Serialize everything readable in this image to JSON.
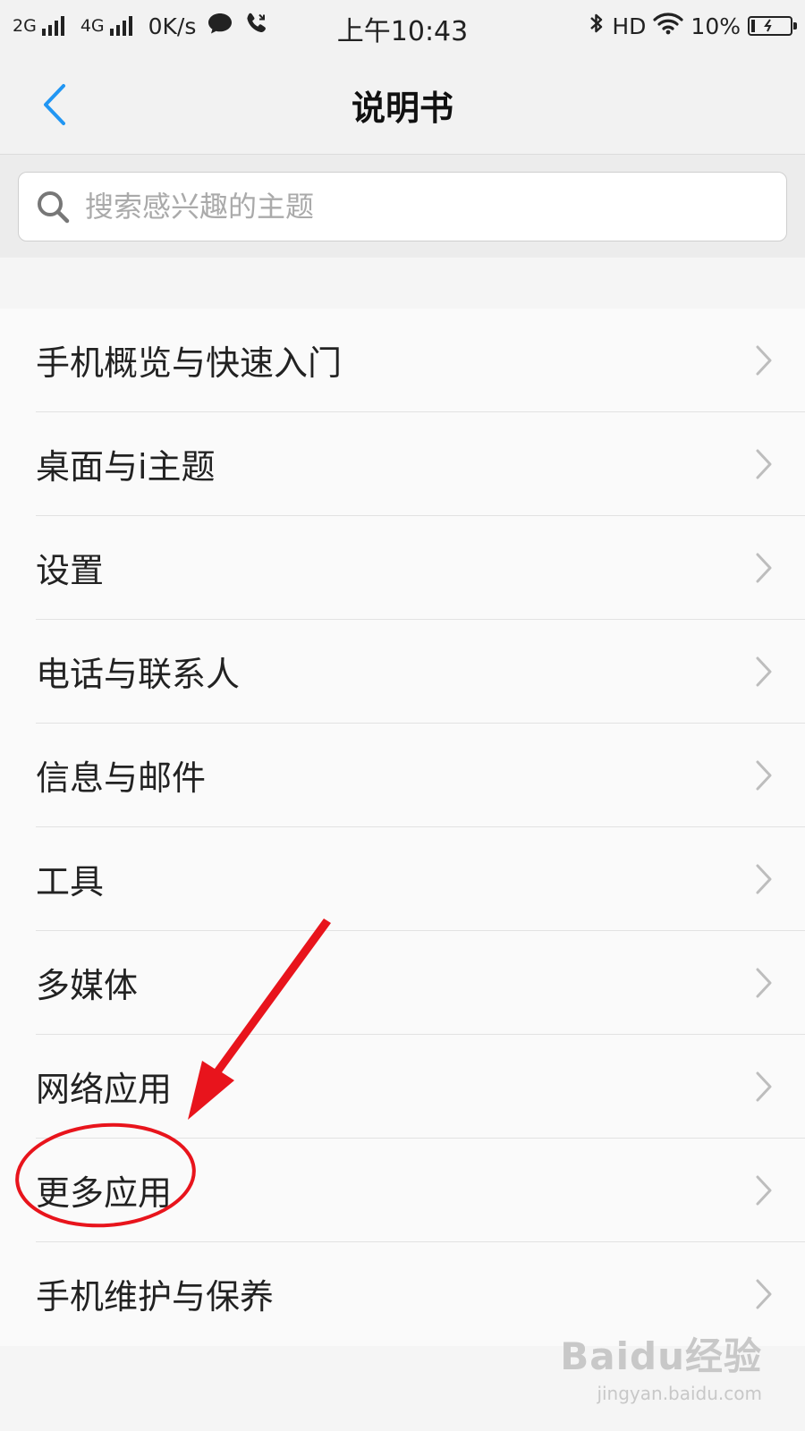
{
  "status_bar": {
    "network_1": "2G",
    "network_2": "4G",
    "speed": "0K/s",
    "time": "上午10:43",
    "hd": "HD",
    "battery_percent": "10%",
    "battery_level": 0.1,
    "icons": [
      "chat-bubble-icon",
      "phone-call-icon",
      "bluetooth-icon",
      "wifi-icon",
      "battery-icon"
    ]
  },
  "header": {
    "title": "说明书",
    "back_icon": "chevron-left-icon",
    "accent_color": "#2196f3"
  },
  "search": {
    "placeholder": "搜索感兴趣的主题",
    "value": ""
  },
  "menu": {
    "items": [
      {
        "label": "手机概览与快速入门"
      },
      {
        "label": "桌面与i主题"
      },
      {
        "label": "设置"
      },
      {
        "label": "电话与联系人"
      },
      {
        "label": "信息与邮件"
      },
      {
        "label": "工具"
      },
      {
        "label": "多媒体"
      },
      {
        "label": "网络应用"
      },
      {
        "label": "更多应用"
      },
      {
        "label": "手机维护与保养"
      }
    ]
  },
  "annotation": {
    "color": "#e8141c",
    "highlighted_item": "更多应用"
  },
  "watermark": {
    "logo": "Baidu经验",
    "url": "jingyan.baidu.com"
  }
}
